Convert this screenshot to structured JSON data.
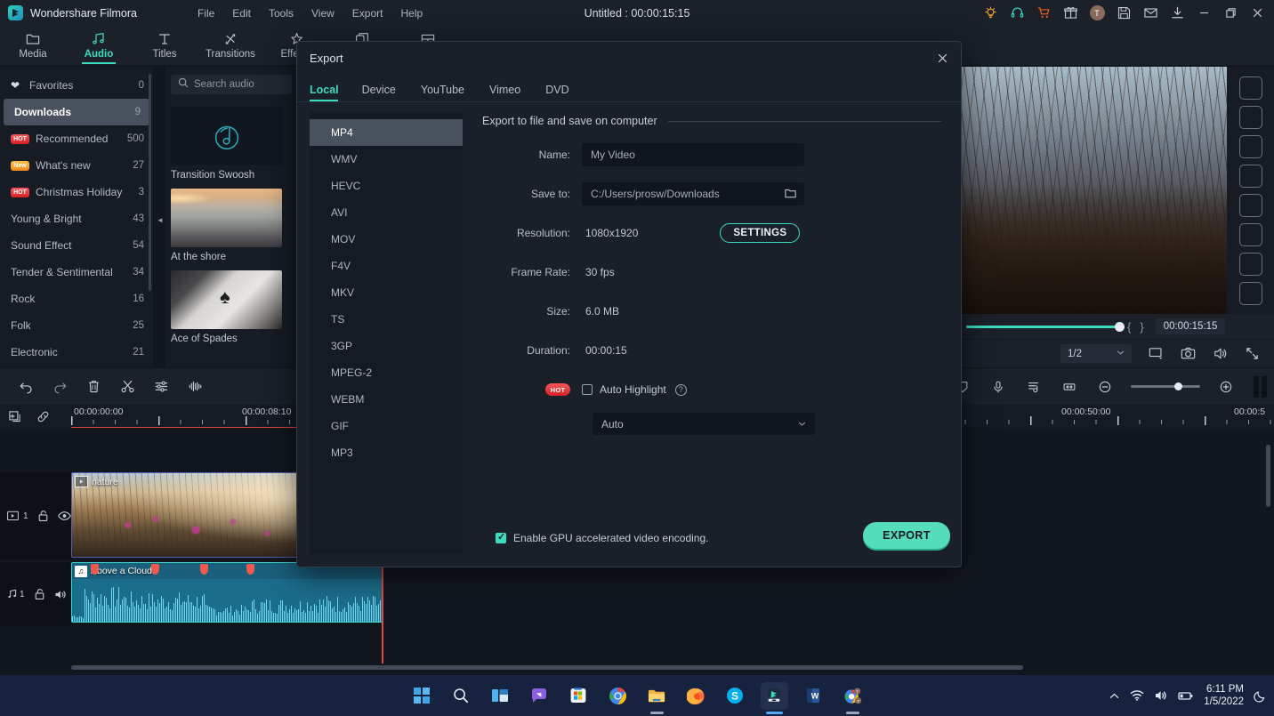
{
  "titlebar": {
    "brand": "Wondershare Filmora",
    "doc_title": "Untitled : 00:00:15:15",
    "menus": [
      "File",
      "Edit",
      "Tools",
      "View",
      "Export",
      "Help"
    ],
    "right_icons": [
      "lightbulb-icon",
      "headset-icon",
      "cart-icon",
      "gift-icon",
      "avatar",
      "save-icon",
      "mail-icon",
      "download-icon",
      "minimize-icon",
      "restore-icon",
      "close-icon"
    ],
    "avatar_letter": "T"
  },
  "toolbar": {
    "tabs": [
      {
        "label": "Media",
        "icon": "folder-icon",
        "active": false
      },
      {
        "label": "Audio",
        "icon": "music-note-icon",
        "active": true
      },
      {
        "label": "Titles",
        "icon": "text-t-icon",
        "active": false
      },
      {
        "label": "Transitions",
        "icon": "transition-icon",
        "active": false
      },
      {
        "label": "Effects",
        "icon": "effects-star-icon",
        "active": false
      },
      {
        "label": "Elements",
        "icon": "elements-icon",
        "active": false
      },
      {
        "label": "Split Screen",
        "icon": "split-screen-icon",
        "active": false
      }
    ]
  },
  "library": {
    "categories": [
      {
        "label": "Favorites",
        "count": "0",
        "badge": "",
        "icon": "heart-icon",
        "selected": false
      },
      {
        "label": "Downloads",
        "count": "9",
        "badge": "",
        "icon": "",
        "selected": true
      },
      {
        "label": "Recommended",
        "count": "500",
        "badge": "HOT",
        "icon": "",
        "selected": false
      },
      {
        "label": "What's new",
        "count": "27",
        "badge": "New",
        "icon": "",
        "selected": false
      },
      {
        "label": "Christmas Holiday",
        "count": "3",
        "badge": "HOT",
        "icon": "",
        "selected": false
      },
      {
        "label": "Young & Bright",
        "count": "43",
        "badge": "",
        "icon": "",
        "selected": false
      },
      {
        "label": "Sound Effect",
        "count": "54",
        "badge": "",
        "icon": "",
        "selected": false
      },
      {
        "label": "Tender & Sentimental",
        "count": "34",
        "badge": "",
        "icon": "",
        "selected": false
      },
      {
        "label": "Rock",
        "count": "16",
        "badge": "",
        "icon": "",
        "selected": false
      },
      {
        "label": "Folk",
        "count": "25",
        "badge": "",
        "icon": "",
        "selected": false
      },
      {
        "label": "Electronic",
        "count": "21",
        "badge": "",
        "icon": "",
        "selected": false
      }
    ],
    "search_placeholder": "Search audio",
    "search_value": "",
    "items": [
      {
        "label": "Transition Swoosh",
        "thumb": "music-disc-icon"
      },
      {
        "label": "At the shore",
        "thumb": "beach-photo"
      },
      {
        "label": "Ace of Spades",
        "thumb": "card-photo"
      }
    ]
  },
  "preview": {
    "timecode": "00:00:15:15",
    "ratio": "1/2",
    "transport_icons": [
      "mark-in-brace",
      "mark-out-brace",
      "display-icon",
      "snapshot-camera-icon",
      "volume-icon",
      "fullscreen-icon"
    ]
  },
  "timeline": {
    "toolbar_icons": [
      "undo-icon",
      "redo-icon",
      "delete-icon",
      "split-scissors-icon",
      "adjust-sliders-icon",
      "audio-detach-icon"
    ],
    "right_icons": [
      "marker-shield-icon",
      "record-mic-icon",
      "audio-mix-icon",
      "fit-timeline-icon",
      "zoom-out-icon",
      "zoom-in-icon",
      "pause-icon"
    ],
    "header_icons": [
      "add-media-icon",
      "link-icon"
    ],
    "ruler_labels": [
      "00:00:00:00",
      "00:00:08:10",
      "00:00:50:00",
      "00:00:5"
    ],
    "video_track": {
      "number": "1",
      "clip_title": "nature",
      "lock_icon": "unlock-icon",
      "eye_icon": "eye-icon"
    },
    "audio_track": {
      "number": "1",
      "clip_title": "Above a Cloud",
      "lock_icon": "unlock-icon",
      "mute_icon": "speaker-icon",
      "marker_count": 4
    }
  },
  "export_dialog": {
    "title": "Export",
    "tabs": [
      "Local",
      "Device",
      "YouTube",
      "Vimeo",
      "DVD"
    ],
    "active_tab": "Local",
    "formats": [
      "MP4",
      "WMV",
      "HEVC",
      "AVI",
      "MOV",
      "F4V",
      "MKV",
      "TS",
      "3GP",
      "MPEG-2",
      "WEBM",
      "GIF",
      "MP3"
    ],
    "selected_format": "MP4",
    "section_title": "Export to file and save on computer",
    "fields": {
      "name_label": "Name:",
      "name_value": "My Video",
      "saveto_label": "Save to:",
      "saveto_value": "C:/Users/prosw/Downloads",
      "resolution_label": "Resolution:",
      "resolution_value": "1080x1920",
      "settings_button": "SETTINGS",
      "framerate_label": "Frame Rate:",
      "framerate_value": "30 fps",
      "size_label": "Size:",
      "size_value": "6.0 MB",
      "duration_label": "Duration:",
      "duration_value": "00:00:15"
    },
    "auto_highlight": {
      "badge": "HOT",
      "label": "Auto Highlight",
      "checked": false,
      "help_icon": "question-icon"
    },
    "auto_select_value": "Auto",
    "gpu_label": "Enable GPU accelerated video encoding.",
    "gpu_checked": true,
    "export_button": "EXPORT",
    "close_icon": "close-icon"
  },
  "taskbar": {
    "apps": [
      {
        "name": "start-windows-icon",
        "active": false
      },
      {
        "name": "search-icon",
        "active": false
      },
      {
        "name": "task-view-icon",
        "active": false
      },
      {
        "name": "chat-teams-icon",
        "active": false
      },
      {
        "name": "microsoft-store-icon",
        "active": false
      },
      {
        "name": "google-chrome-icon",
        "active": false
      },
      {
        "name": "file-explorer-icon",
        "active": false
      },
      {
        "name": "firefox-icon",
        "active": false
      },
      {
        "name": "skype-icon",
        "active": false
      },
      {
        "name": "filmora-icon",
        "active": true
      },
      {
        "name": "microsoft-word-icon",
        "active": false
      },
      {
        "name": "chrome-profile-icon",
        "active": false
      }
    ],
    "tray_icons": [
      "show-hidden-icons-chevron",
      "wifi-icon",
      "volume-icon",
      "battery-icon",
      "moon-icon"
    ],
    "time": "6:11 PM",
    "date": "1/5/2022"
  },
  "colors": {
    "accent_teal": "#3ddbbe",
    "export_button": "#55dcbb",
    "hot_badge": "#d81f25",
    "new_badge": "#f08a1c",
    "playhead_red": "#e2483f",
    "window_bg": "#1b2029",
    "panel_bg": "#161b24",
    "taskbar_bg": "#16223e"
  }
}
